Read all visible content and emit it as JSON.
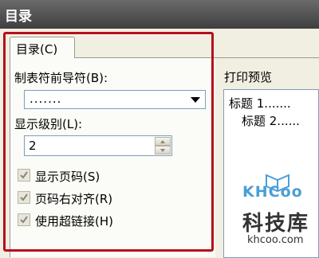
{
  "window": {
    "title": "目录"
  },
  "tabs": [
    {
      "label": "目录(C)"
    }
  ],
  "leader": {
    "label": "制表符前导符(B):",
    "value": "......."
  },
  "levels": {
    "label": "显示级别(L):",
    "value": "2"
  },
  "checkboxes": [
    {
      "label": "显示页码(S)",
      "checked": true
    },
    {
      "label": "页码右对齐(R)",
      "checked": true
    },
    {
      "label": "使用超链接(H)",
      "checked": true
    }
  ],
  "preview": {
    "title": "打印预览",
    "lines": [
      "标题 1.......",
      "标题 2......"
    ]
  },
  "watermark": {
    "logo": "KHCoo",
    "name": "科技库",
    "url": "khcoo.com"
  },
  "colors": {
    "highlight": "#b5101c",
    "titlebar": "#4a4a4a",
    "watermark_blue": "#4a9fd6"
  }
}
